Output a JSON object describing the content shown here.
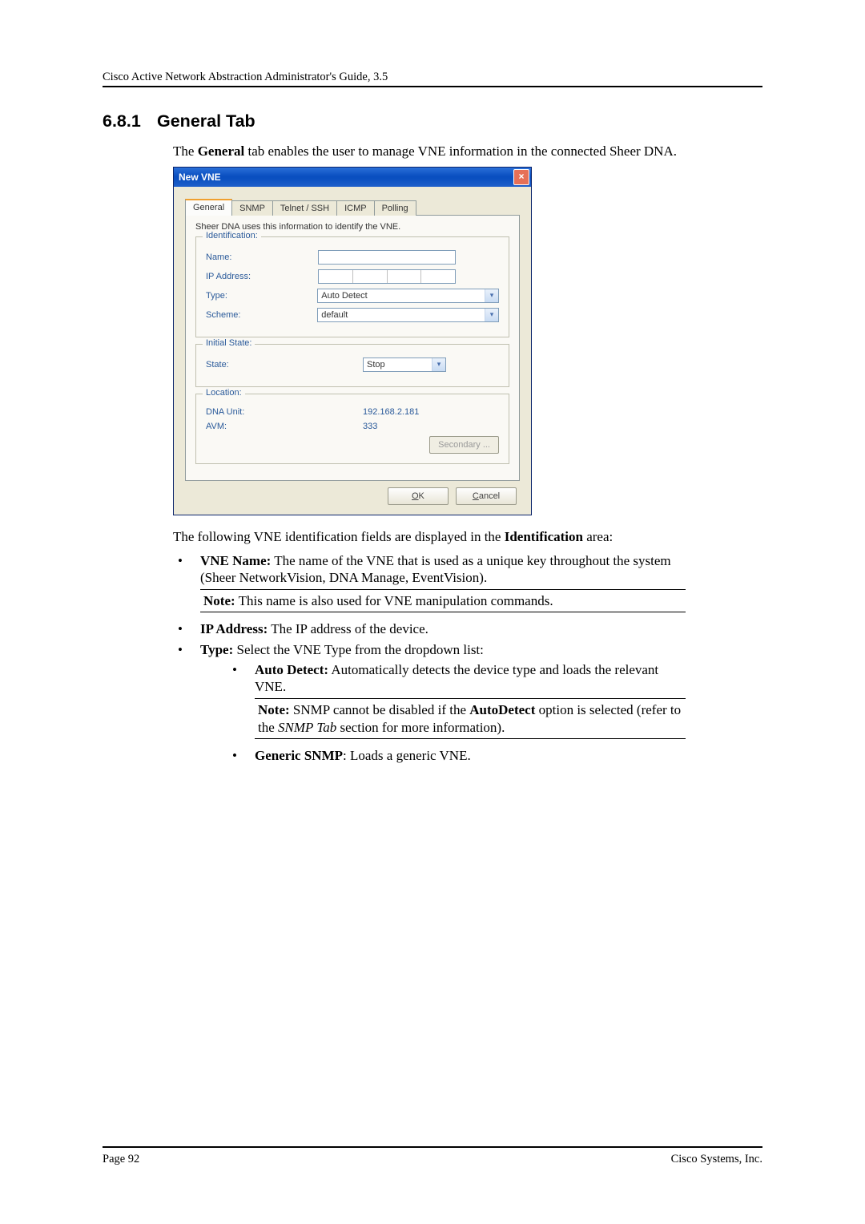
{
  "header": {
    "running": "Cisco Active Network Abstraction Administrator's Guide, 3.5"
  },
  "section": {
    "number": "6.8.1",
    "title": "General Tab"
  },
  "intro": {
    "prefix": "The ",
    "bold": "General",
    "suffix": " tab enables the user to manage VNE information in the connected Sheer DNA."
  },
  "dialog": {
    "title": "New VNE",
    "tabs": [
      "General",
      "SNMP",
      "Telnet / SSH",
      "ICMP",
      "Polling"
    ],
    "info_text": "Sheer DNA uses this information to identify the VNE.",
    "identification": {
      "legend": "Identification:",
      "name_label": "Name:",
      "name_value": "",
      "ip_label": "IP Address:",
      "type_label": "Type:",
      "type_value": "Auto Detect",
      "scheme_label": "Scheme:",
      "scheme_value": "default"
    },
    "initial_state": {
      "legend": "Initial State:",
      "state_label": "State:",
      "state_value": "Stop"
    },
    "location": {
      "legend": "Location:",
      "dna_unit_label": "DNA Unit:",
      "dna_unit_value": "192.168.2.181",
      "avm_label": "AVM:",
      "avm_value": "333",
      "secondary_button": "Secondary ..."
    },
    "buttons": {
      "ok": "OK",
      "cancel": "Cancel"
    }
  },
  "post": {
    "lead_prefix": "The following VNE identification fields are displayed in the ",
    "lead_bold": "Identification",
    "lead_suffix": " area:",
    "b1_bold": "VNE Name:",
    "b1_text": " The name of the VNE that is used as a unique key throughout the system (Sheer NetworkVision, DNA Manage, EventVision).",
    "b1_note_bold": "Note:",
    "b1_note_text": " This name is also used for VNE manipulation commands.",
    "b2_bold": "IP Address:",
    "b2_text": " The IP address of the device.",
    "b3_bold": "Type:",
    "b3_text": " Select the VNE Type from the dropdown list:",
    "b3a_bold": "Auto Detect:",
    "b3a_text": " Automatically detects the device type and loads the relevant VNE.",
    "b3a_note_bold": "Note:",
    "b3a_note_mid1": " SNMP cannot be disabled if the ",
    "b3a_note_bold2": "AutoDetect",
    "b3a_note_mid2": " option is selected (refer to the ",
    "b3a_note_italic": "SNMP Tab",
    "b3a_note_end": " section for more information).",
    "b3b_bold": "Generic SNMP",
    "b3b_text": ": Loads a generic VNE."
  },
  "footer": {
    "left": "Page 92",
    "right": "Cisco Systems, Inc."
  }
}
